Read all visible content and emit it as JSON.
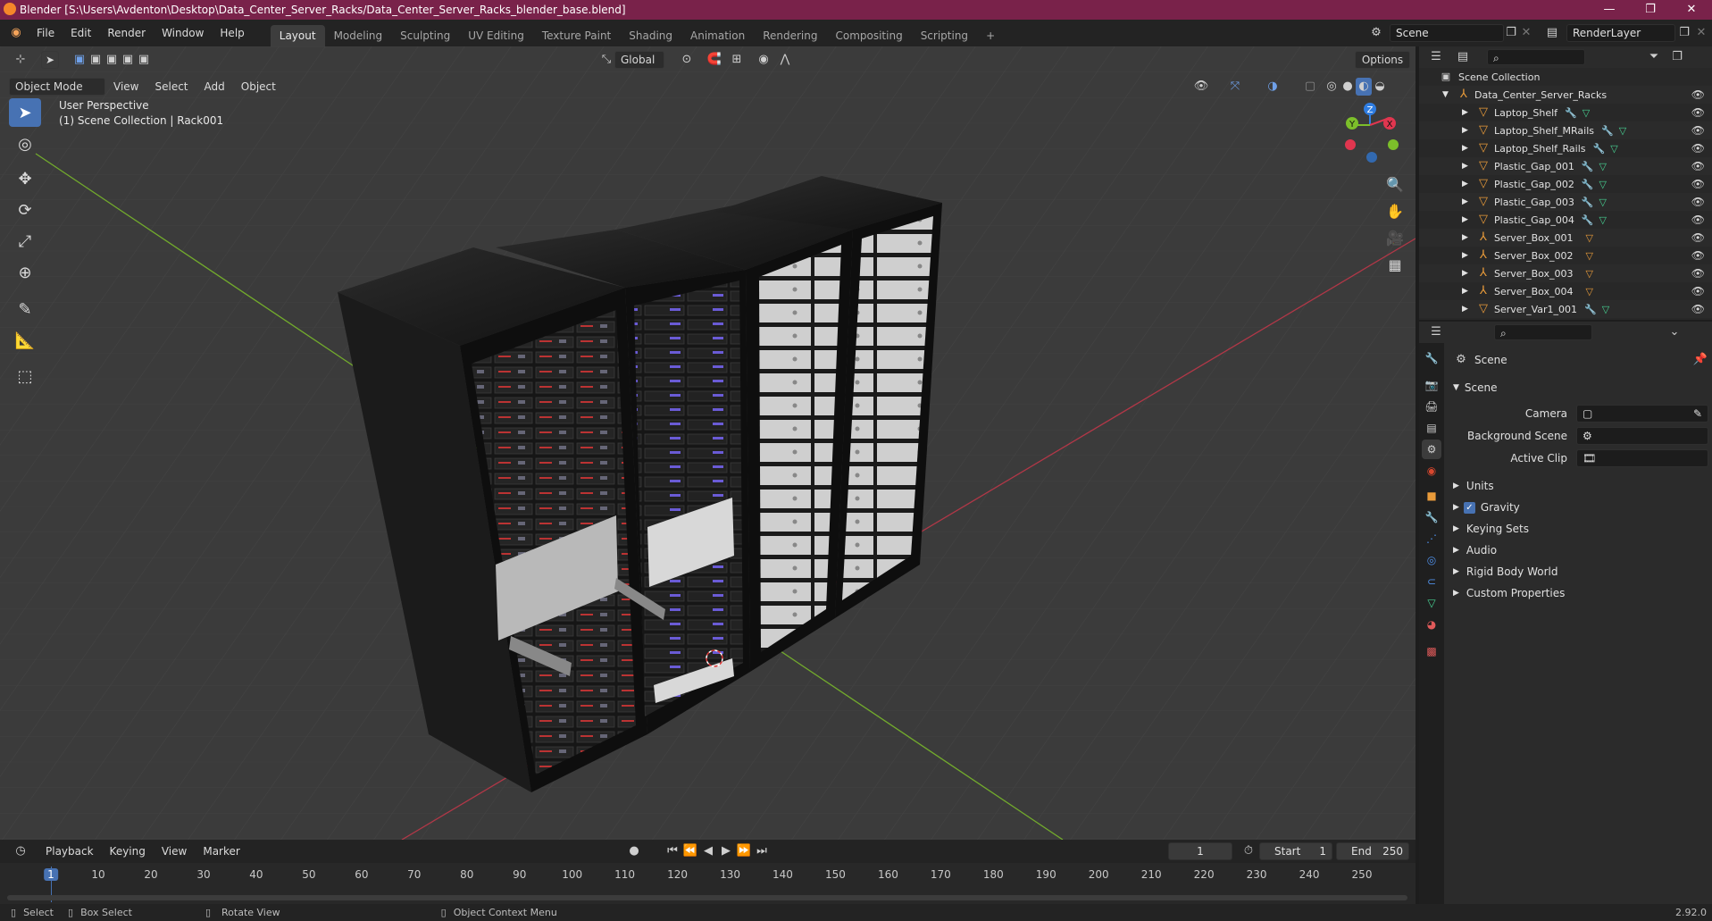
{
  "window": {
    "title": "Blender [S:\\Users\\Avdenton\\Desktop\\Data_Center_Server_Racks/Data_Center_Server_Racks_blender_base.blend]",
    "minimize": "—",
    "maximize": "❐",
    "close": "✕"
  },
  "menus": [
    "File",
    "Edit",
    "Render",
    "Window",
    "Help"
  ],
  "workspaces": [
    "Layout",
    "Modeling",
    "Sculpting",
    "UV Editing",
    "Texture Paint",
    "Shading",
    "Animation",
    "Rendering",
    "Compositing",
    "Scripting"
  ],
  "active_workspace": "Layout",
  "add_workspace": "+",
  "scene_selector": {
    "value": "Scene"
  },
  "renderlayer_selector": {
    "value": "RenderLayer"
  },
  "viewport": {
    "transform_orientation": "Global",
    "options_label": "Options",
    "mode": "Object Mode",
    "menu": [
      "View",
      "Select",
      "Add",
      "Object"
    ],
    "overlay_line1": "User Perspective",
    "overlay_line2": "(1) Scene Collection | Rack001",
    "gizmo": {
      "z": "Z",
      "y": "Y",
      "x": "X"
    }
  },
  "outliner": {
    "root": "Scene Collection",
    "collection": "Data_Center_Server_Racks",
    "items": [
      {
        "name": "Laptop_Shelf",
        "kind": "mesh"
      },
      {
        "name": "Laptop_Shelf_MRails",
        "kind": "mesh"
      },
      {
        "name": "Laptop_Shelf_Rails",
        "kind": "mesh"
      },
      {
        "name": "Plastic_Gap_001",
        "kind": "mesh"
      },
      {
        "name": "Plastic_Gap_002",
        "kind": "mesh"
      },
      {
        "name": "Plastic_Gap_003",
        "kind": "mesh"
      },
      {
        "name": "Plastic_Gap_004",
        "kind": "mesh"
      },
      {
        "name": "Server_Box_001",
        "kind": "empty"
      },
      {
        "name": "Server_Box_002",
        "kind": "empty"
      },
      {
        "name": "Server_Box_003",
        "kind": "empty"
      },
      {
        "name": "Server_Box_004",
        "kind": "empty"
      },
      {
        "name": "Server_Var1_001",
        "kind": "mesh"
      }
    ]
  },
  "properties": {
    "context_title": "Scene",
    "panel_title": "Scene",
    "fields": [
      {
        "label": "Camera",
        "value": ""
      },
      {
        "label": "Background Scene",
        "value": ""
      },
      {
        "label": "Active Clip",
        "value": ""
      }
    ],
    "sections": [
      "Units",
      "Gravity",
      "Keying Sets",
      "Audio",
      "Rigid Body World",
      "Custom Properties"
    ],
    "gravity_checked": true
  },
  "timeline": {
    "menu": [
      "Playback",
      "Keying",
      "View",
      "Marker"
    ],
    "current_frame": "1",
    "start_label": "Start",
    "start_value": "1",
    "end_label": "End",
    "end_value": "250",
    "ticks": [
      "1",
      "10",
      "20",
      "30",
      "40",
      "50",
      "60",
      "70",
      "80",
      "90",
      "100",
      "110",
      "120",
      "130",
      "140",
      "150",
      "160",
      "170",
      "180",
      "190",
      "200",
      "210",
      "220",
      "230",
      "240",
      "250"
    ]
  },
  "statusbar": {
    "select": "Select",
    "box_select": "Box Select",
    "rotate_view": "Rotate View",
    "context_menu": "Object Context Menu",
    "version": "2.92.0"
  },
  "colors": {
    "title_bar": "#79224a",
    "active_blue": "#4772b3",
    "axis_red": "#e0364f",
    "axis_green": "#7cbf2a",
    "axis_blue": "#2f7de1",
    "mesh_orange": "#e99b3a",
    "mesh_data_green": "#47d192"
  }
}
